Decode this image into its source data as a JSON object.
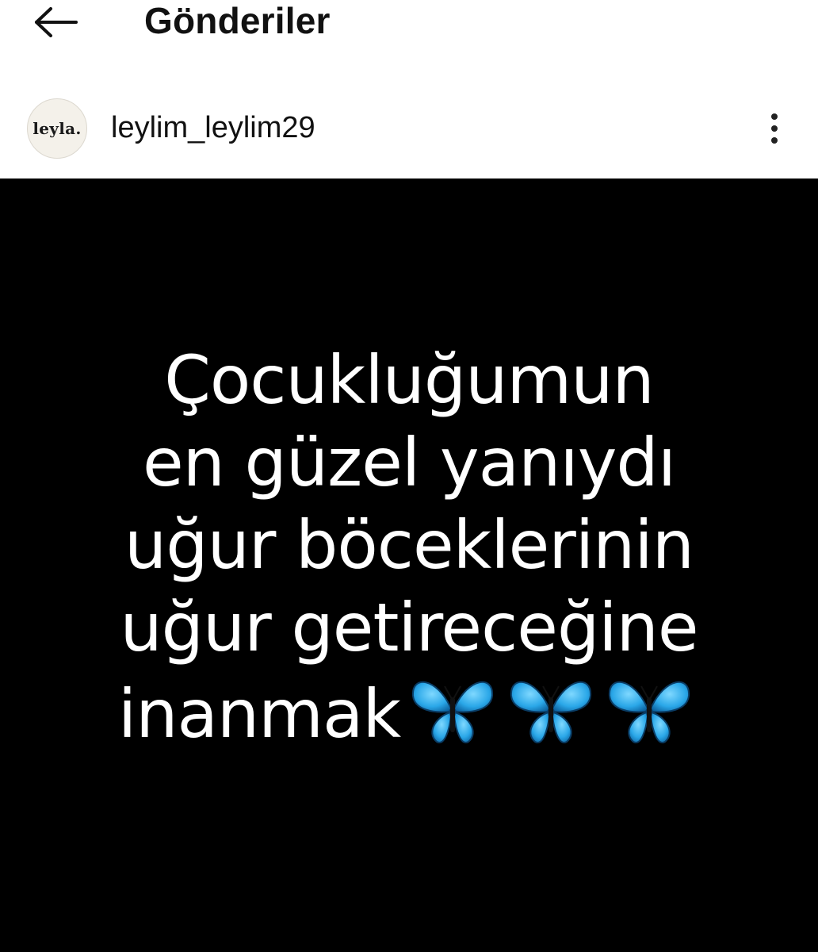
{
  "header": {
    "title": "Gönderiler"
  },
  "post": {
    "username": "leylim_leylim29",
    "avatar_text": "leyla.",
    "image_text": {
      "lines": [
        "Çocukluğumun",
        "en güzel yanıydı",
        "uğur böceklerinin",
        "uğur getireceğine",
        "inanmak"
      ],
      "emoji": "🦋🦋🦋"
    }
  },
  "icons": {
    "back": "arrow-left-icon",
    "more": "more-vertical-icon",
    "butterfly": "butterfly-emoji"
  },
  "colors": {
    "header_bg": "#ffffff",
    "image_bg": "#000000",
    "image_text": "#ffffff",
    "butterfly_blue": "#2aa7e8"
  }
}
